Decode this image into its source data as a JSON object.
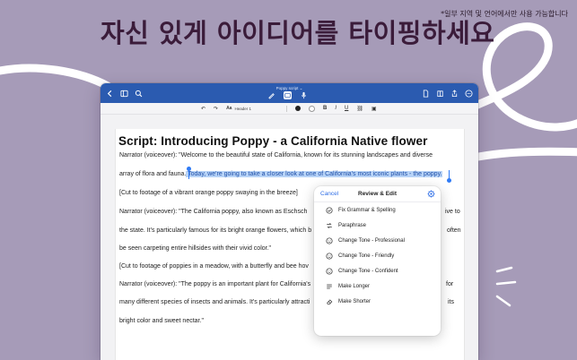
{
  "promo": {
    "headline": "자신 있게 아이디어를 타이핑하세요",
    "footnote": "*일부 지역 및 언어에서만 사용 가능합니다"
  },
  "titlebar": {
    "doc_title": "Poppy script ⌄",
    "accent": "#2b5bb0"
  },
  "formatbar": {
    "style_label": "Header 1",
    "bold": "B",
    "italic": "I",
    "underline": "U"
  },
  "document": {
    "heading": "Script: Introducing Poppy - a California Native flower",
    "lines": [
      "Narrator (voiceover): \"Welcome to the beautiful state of California, known for its stunning landscapes and diverse",
      "array of flora and fauna.",
      "[Cut to footage of a vibrant orange poppy swaying in the breeze]",
      "Narrator (voiceover): \"The California poppy, also known as Eschsch",
      "the state. It's particularly famous for its bright orange flowers, which b",
      "be seen carpeting entire hillsides with their vivid color.\"",
      "[Cut to footage of poppies in a meadow, with a butterfly and bee hov",
      "Narrator (voiceover): \"The poppy is an important plant for California's",
      "many different species of insects and animals. It's particularly attracti",
      "bright color and sweet nectar.\""
    ],
    "selected_text": " Today, we're going to take a closer look at one of California's most iconic plants - the poppy.",
    "right_fragments": {
      "line4": "ive to",
      "line5": "often",
      "line8": "for",
      "line9": "its"
    }
  },
  "menu": {
    "cancel": "Cancel",
    "title": "Review & Edit",
    "items": [
      {
        "label": "Fix Grammar & Spelling",
        "icon": "check-circle-icon"
      },
      {
        "label": "Paraphrase",
        "icon": "paraphrase-icon"
      },
      {
        "label": "Change Tone - Professional",
        "icon": "smiley-icon"
      },
      {
        "label": "Change Tone - Friendly",
        "icon": "smiley-icon"
      },
      {
        "label": "Change Tone - Confident",
        "icon": "smiley-icon"
      },
      {
        "label": "Make Longer",
        "icon": "lines-icon"
      },
      {
        "label": "Make Shorter",
        "icon": "eraser-icon"
      }
    ]
  }
}
